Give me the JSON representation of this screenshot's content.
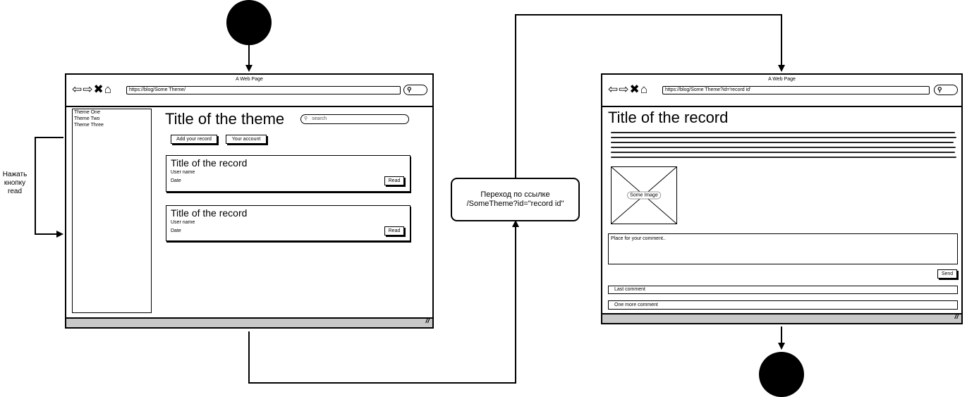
{
  "window_left": {
    "title": "A Web Page",
    "url": "https://blog/Some Theme/",
    "sidebar_items": [
      "Theme One",
      "Theme Two",
      "Theme Three"
    ],
    "page_title": "Title of the theme",
    "search_placeholder": "search",
    "add_record_label": "Add your record",
    "account_label": "Your account",
    "records": [
      {
        "title": "Title of the record",
        "user": "User name",
        "date": "Date",
        "read_label": "Read"
      },
      {
        "title": "Title of the record",
        "user": "User name",
        "date": "Date",
        "read_label": "Read"
      }
    ]
  },
  "window_right": {
    "title": "A Web Page",
    "url": "https://blog/Some Theme?id='record id'",
    "page_title": "Title of the record",
    "image_label": "Some Image",
    "comment_placeholder": "Place for your comment..",
    "send_label": "Send",
    "comments": [
      "Last comment",
      "One more comment"
    ]
  },
  "annotations": {
    "press_read": [
      "Нажать",
      "кнопку",
      "read"
    ],
    "transition": [
      "Переход по ссылке",
      "/SomeTheme?id=\"record id\""
    ]
  },
  "icons": {
    "nav": "back-forward-close-home-icons",
    "search": "magnifier-icon",
    "resize": "resize-grip-icon"
  }
}
